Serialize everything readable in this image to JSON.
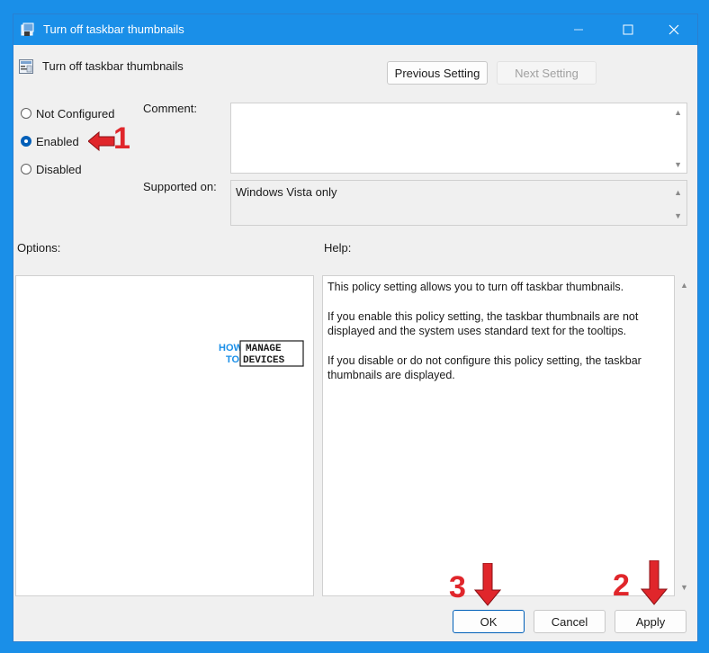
{
  "window": {
    "title": "Turn off taskbar thumbnails"
  },
  "header": {
    "title": "Turn off taskbar thumbnails",
    "previous_label": "Previous Setting",
    "next_label": "Next Setting"
  },
  "state": {
    "options": [
      {
        "label": "Not Configured",
        "checked": false
      },
      {
        "label": "Enabled",
        "checked": true
      },
      {
        "label": "Disabled",
        "checked": false
      }
    ]
  },
  "comment": {
    "label": "Comment:",
    "value": ""
  },
  "supported": {
    "label": "Supported on:",
    "value": "Windows Vista only"
  },
  "options_section": {
    "label": "Options:"
  },
  "help_section": {
    "label": "Help:",
    "paragraphs": [
      "This policy setting allows you to turn off taskbar thumbnails.",
      "If you enable this policy setting, the taskbar thumbnails are not displayed and the system uses standard text for the tooltips.",
      "If you disable or do not configure this policy setting, the taskbar thumbnails are displayed."
    ]
  },
  "footer": {
    "ok_label": "OK",
    "cancel_label": "Cancel",
    "apply_label": "Apply"
  },
  "annotations": {
    "step1": "1",
    "step2": "2",
    "step3": "3",
    "color": "#e0262b"
  },
  "watermark": {
    "how": "HOW",
    "to": "TO",
    "manage": "MANAGE",
    "devices": "DEVICES"
  },
  "colors": {
    "accent": "#005fb8",
    "titlebar": "#1a8fe8"
  }
}
